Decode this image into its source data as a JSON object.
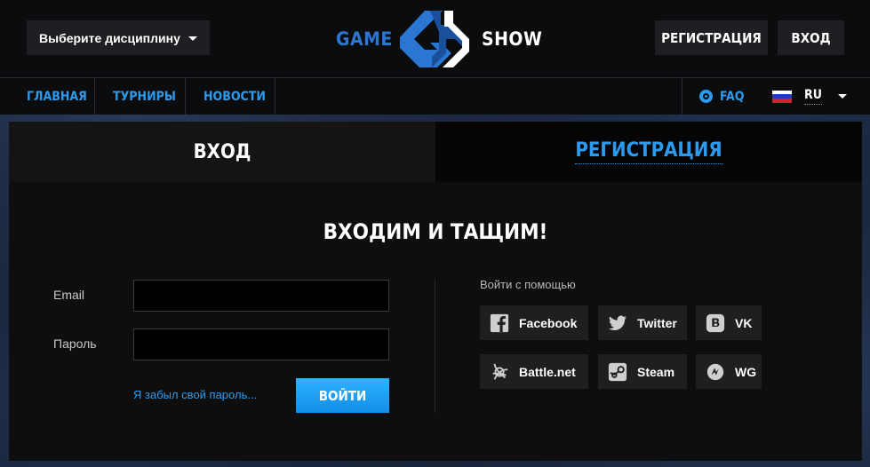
{
  "header": {
    "discipline_label": "Выберите дисциплину",
    "logo_left": "GAME",
    "logo_right": "SHOW",
    "register_label": "РЕГИСТРАЦИЯ",
    "login_label": "ВХОД"
  },
  "nav": {
    "items": [
      {
        "label": "ГЛАВНАЯ"
      },
      {
        "label": "ТУРНИРЫ"
      },
      {
        "label": "НОВОСТИ"
      }
    ],
    "faq_label": "FAQ",
    "language": "RU"
  },
  "auth": {
    "tabs": {
      "login": "ВХОД",
      "register": "РЕГИСТРАЦИЯ"
    },
    "heading": "ВХОДИМ И ТАЩИМ!",
    "email_label": "Email",
    "email_value": "",
    "password_label": "Пароль",
    "password_value": "",
    "forgot_label": "Я забыл свой пароль...",
    "submit_label": "ВОЙТИ",
    "social_title": "Войти с помощью",
    "social": [
      {
        "label": "Facebook",
        "icon": "facebook-icon"
      },
      {
        "label": "Twitter",
        "icon": "twitter-icon"
      },
      {
        "label": "VK",
        "icon": "vk-icon"
      },
      {
        "label": "Battle.net",
        "icon": "battlenet-icon"
      },
      {
        "label": "Steam",
        "icon": "steam-icon"
      },
      {
        "label": "WG",
        "icon": "wargaming-icon"
      }
    ]
  },
  "colors": {
    "accent": "#2b9bf0",
    "logo_blue": "#2b76d2",
    "panel_bg": "#0e0e0f",
    "header_bg": "#0b0c0e",
    "button_dark": "#1e1f22"
  }
}
